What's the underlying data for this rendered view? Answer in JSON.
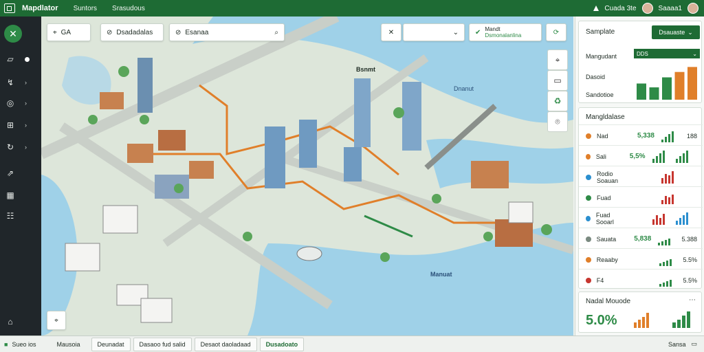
{
  "topbar": {
    "title": "Mapdlator",
    "menu": [
      "Suntors",
      "Srasudous"
    ],
    "user_label": "Cuada 3te",
    "user2_label": "Saaaa1"
  },
  "search": {
    "first_value": "GA",
    "second_value": "Dsadadalas",
    "third_value": "Esanaa",
    "center_field_value": ""
  },
  "map": {
    "tool_title": "Mandt",
    "tool_subtitle": "Dsmonalanlina",
    "labels": [
      "Bsnmt",
      "Dnanut",
      "Manuat"
    ]
  },
  "panel": {
    "card1": {
      "title": "Samplate",
      "button": "Dsauaste",
      "legend_rows": [
        "Mangudant",
        "Dasoid",
        "Sandotioe"
      ],
      "mini_chart_label": "DDS"
    },
    "card2": {
      "title": "Mangldalase",
      "rows": [
        {
          "name": "Nad",
          "value": "5,338",
          "pct": "188"
        },
        {
          "name": "Sali",
          "value": "5,5%",
          "pct": ""
        },
        {
          "name": "Rodio\nSoauan",
          "value": "",
          "pct": ""
        },
        {
          "name": "Fuad",
          "value": "",
          "pct": ""
        },
        {
          "name": "Fuad\nSooarl",
          "value": "",
          "pct": ""
        },
        {
          "name": "Sauata",
          "value": "5,838",
          "pct": "5.388"
        },
        {
          "name": "Reaaby",
          "value": "",
          "pct": "5.5%"
        },
        {
          "name": "F4",
          "value": "",
          "pct": "5.5%"
        }
      ]
    },
    "card3": {
      "title": "Nadal Mouode",
      "value": "5.0%"
    }
  },
  "status": {
    "left": "Sueo ios",
    "tabs": [
      "Mausoia",
      "Deunadat",
      "Dasaoo fud salid",
      "Desaot daoladaad",
      "Dusadoato"
    ],
    "right": "Sansa"
  },
  "colors": {
    "brand": "#1e6b34",
    "accent": "#2e8b47",
    "orange": "#e07f2a",
    "red": "#c7362f",
    "blue": "#2b8fcf"
  },
  "chart_data": {
    "type": "bar",
    "categories": [
      "1",
      "2",
      "3",
      "4",
      "5"
    ],
    "values": [
      0.42,
      0.32,
      0.58,
      0.72,
      0.85
    ],
    "colors": [
      "#2e8b47",
      "#2e8b47",
      "#2e8b47",
      "#e07f2a",
      "#e07f2a"
    ]
  }
}
